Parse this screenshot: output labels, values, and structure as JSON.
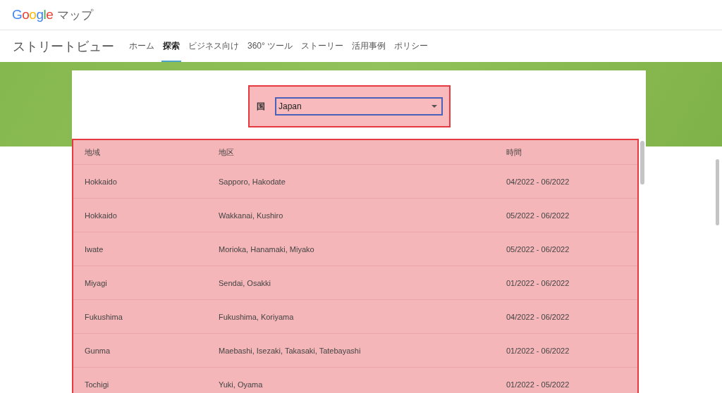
{
  "header": {
    "logo": "Google",
    "product": "マップ"
  },
  "nav": {
    "title": "ストリートビュー",
    "tabs": [
      {
        "label": "ホーム",
        "selected": false
      },
      {
        "label": "探索",
        "selected": true
      },
      {
        "label": "ビジネス向け",
        "selected": false
      },
      {
        "label": "360° ツール",
        "selected": false
      },
      {
        "label": "ストーリー",
        "selected": false
      },
      {
        "label": "活用事例",
        "selected": false
      },
      {
        "label": "ポリシー",
        "selected": false
      }
    ]
  },
  "country_select": {
    "label": "国",
    "value": "Japan"
  },
  "table": {
    "columns": [
      "地域",
      "地区",
      "時間"
    ],
    "rows": [
      [
        "Hokkaido",
        "Sapporo, Hakodate",
        "04/2022 - 06/2022"
      ],
      [
        "Hokkaido",
        "Wakkanai, Kushiro",
        "05/2022 - 06/2022"
      ],
      [
        "Iwate",
        "Morioka, Hanamaki, Miyako",
        "05/2022 - 06/2022"
      ],
      [
        "Miyagi",
        "Sendai, Osakki",
        "01/2022 - 06/2022"
      ],
      [
        "Fukushima",
        "Fukushima, Koriyama",
        "04/2022 - 06/2022"
      ],
      [
        "Gunma",
        "Maebashi, Isezaki, Takasaki, Tatebayashi",
        "01/2022 - 06/2022"
      ],
      [
        "Tochigi",
        "Yuki, Oyama",
        "01/2022 - 05/2022"
      ]
    ]
  }
}
